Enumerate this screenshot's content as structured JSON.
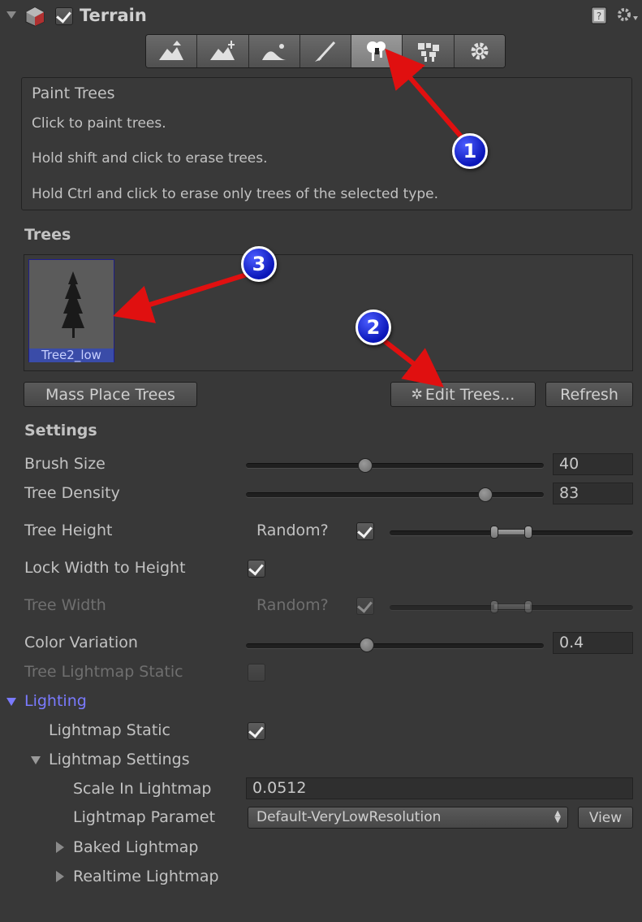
{
  "header": {
    "title": "Terrain",
    "enabled": true
  },
  "toolbar": {
    "tools": [
      "raise-lower-terrain",
      "paint-height",
      "smooth-height",
      "paint-texture",
      "place-trees",
      "paint-details",
      "terrain-settings"
    ],
    "active_index": 4
  },
  "help": {
    "title": "Paint Trees",
    "line1": "Click to paint trees.",
    "line2": "Hold shift and click to erase trees.",
    "line3": "Hold Ctrl and click to erase only trees of the selected type."
  },
  "trees": {
    "heading": "Trees",
    "items": [
      {
        "label": "Tree2_low"
      }
    ]
  },
  "buttons": {
    "mass_place": "Mass Place Trees",
    "edit_trees": "Edit Trees...",
    "refresh": "Refresh"
  },
  "settings": {
    "heading": "Settings",
    "brush_size": {
      "label": "Brush Size",
      "value": "40",
      "fraction": 0.4
    },
    "tree_density": {
      "label": "Tree Density",
      "value": "83",
      "fraction": 0.83
    },
    "tree_height": {
      "label": "Tree Height",
      "random_label": "Random?",
      "random": true
    },
    "lock_width": {
      "label": "Lock Width to Height",
      "checked": true
    },
    "tree_width": {
      "label": "Tree Width",
      "random_label": "Random?",
      "random": true
    },
    "color_variation": {
      "label": "Color Variation",
      "value": "0.4",
      "fraction": 0.4
    },
    "tree_lightmap_static": {
      "label": "Tree Lightmap Static",
      "checked": false
    }
  },
  "lighting": {
    "heading": "Lighting",
    "lightmap_static": {
      "label": "Lightmap Static",
      "checked": true
    },
    "lightmap_settings": "Lightmap Settings",
    "scale_in_lightmap": {
      "label": "Scale In Lightmap",
      "value": "0.0512"
    },
    "lightmap_param": {
      "label": "Lightmap Paramet",
      "value": "Default-VeryLowResolution",
      "view": "View"
    },
    "baked_lightmap": "Baked Lightmap",
    "realtime_lightmap": "Realtime Lightmap"
  },
  "annotations": [
    "1",
    "2",
    "3"
  ],
  "colors": {
    "background": "#383838",
    "lighting_heading": "#7a7aff",
    "annotation_arrow": "#e01010",
    "annotation_badge": "#1020d0"
  }
}
